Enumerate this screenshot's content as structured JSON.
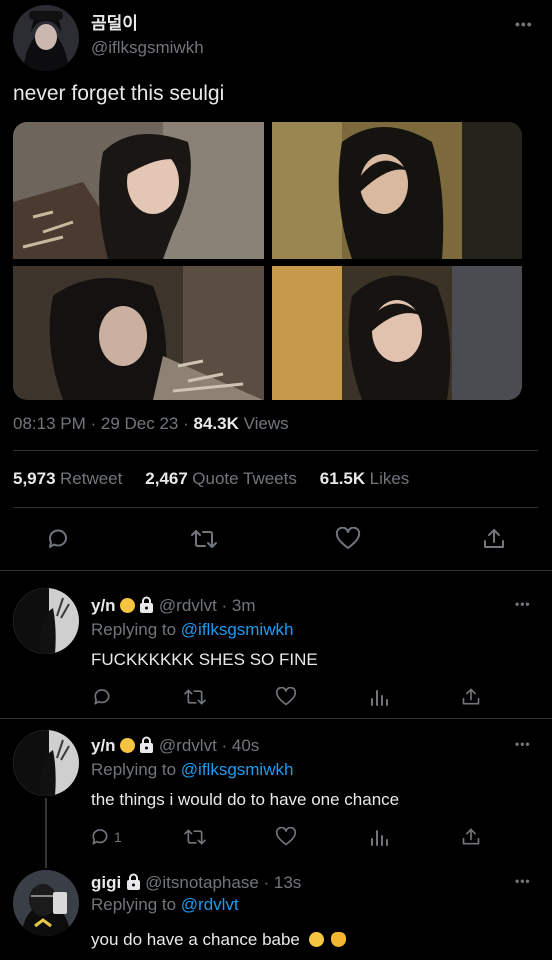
{
  "tweet": {
    "author_name": "곰덜이",
    "author_handle": "@iflksgsmiwkh",
    "text": "never forget this seulgi",
    "timestamp": "08:13 PM · 29 Dec 23 · ",
    "views_count": "84.3K",
    "views_label": " Views",
    "stats": {
      "retweets_count": "5,973",
      "retweets_label": "Retweet",
      "quotes_count": "2,467",
      "quotes_label": "Quote Tweets",
      "likes_count": "61.5K",
      "likes_label": "Likes"
    },
    "more_label": "•••"
  },
  "replies": [
    {
      "name": "y/n",
      "handle": "@rdvlvt · 3m",
      "replying_prefix": "Replying to ",
      "replying_to": "@iflksgsmiwkh",
      "text": "FUCKKKKKK SHES SO FINE",
      "reply_count": ""
    },
    {
      "name": "y/n",
      "handle": "@rdvlvt · 40s",
      "replying_prefix": "Replying to ",
      "replying_to": "@iflksgsmiwkh",
      "text": "the things i would do to have one chance",
      "reply_count": "1"
    },
    {
      "name": "gigi",
      "handle": "@itsnotaphase · 13s",
      "replying_prefix": "Replying to ",
      "replying_to": "@rdvlvt",
      "text": "you do have a chance babe"
    }
  ],
  "colors": {
    "background": "#000000",
    "text": "#e7e9ea",
    "muted": "#71767b",
    "link": "#1d9bf0",
    "divider": "#2f3336"
  },
  "icons": [
    "reply-icon",
    "retweet-icon",
    "like-icon",
    "share-icon",
    "views-icon",
    "lock-icon",
    "more-icon"
  ]
}
